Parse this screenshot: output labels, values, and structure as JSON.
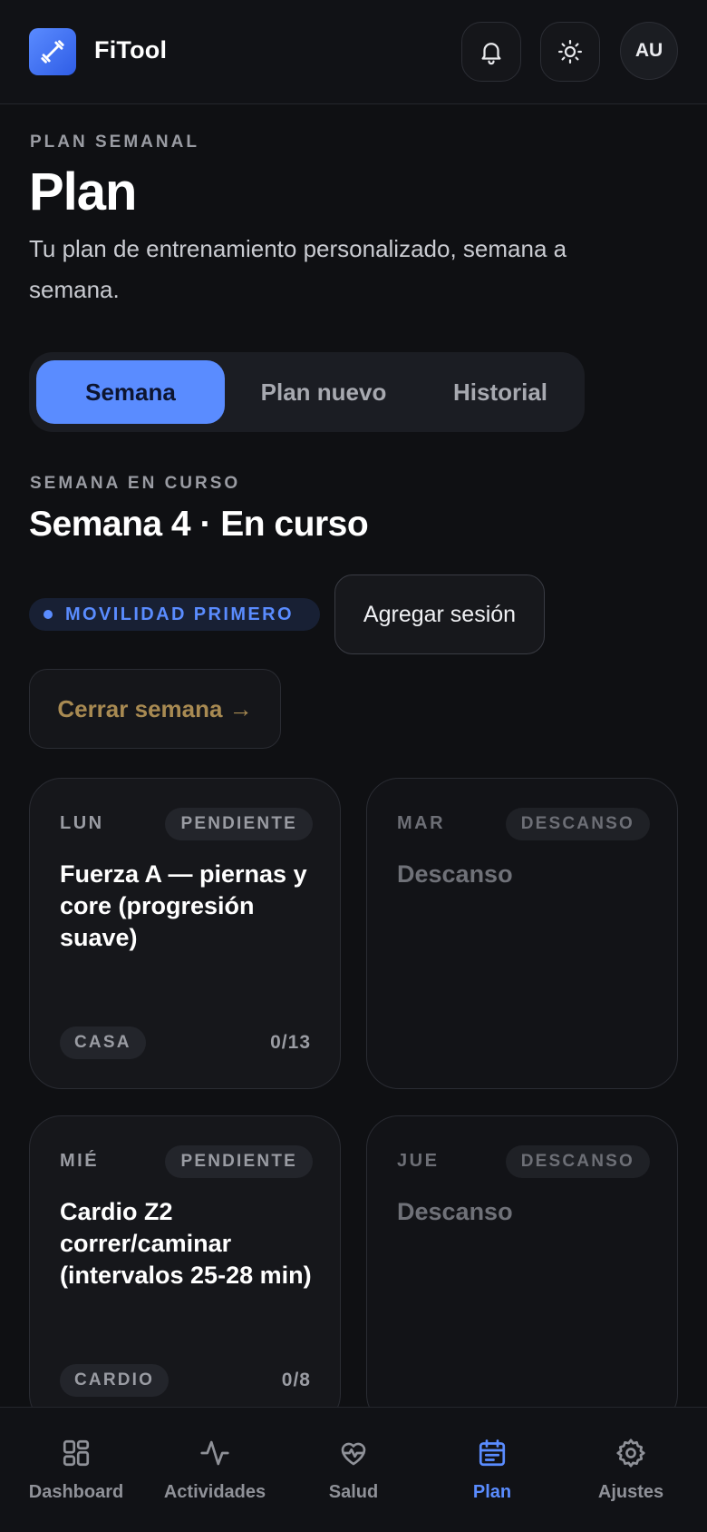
{
  "app": {
    "name": "FiTool",
    "avatar_initials": "AU"
  },
  "header": {
    "eyebrow": "PLAN SEMANAL",
    "title": "Plan",
    "subtitle": "Tu plan de entrenamiento personalizado, semana a semana."
  },
  "tabs": [
    {
      "label": "Semana",
      "active": true
    },
    {
      "label": "Plan nuevo",
      "active": false
    },
    {
      "label": "Historial",
      "active": false
    }
  ],
  "week": {
    "eyebrow": "SEMANA EN CURSO",
    "title": "Semana 4 · En curso",
    "focus_badge": "MOVILIDAD PRIMERO",
    "add_session_label": "Agregar sesión",
    "close_week_label": "Cerrar semana →"
  },
  "days": [
    {
      "day": "LUN",
      "status": "PENDIENTE",
      "title": "Fuerza A — piernas y core (progresión suave)",
      "tag": "CASA",
      "count": "0/13"
    },
    {
      "day": "MAR",
      "status": "DESCANSO",
      "title": "Descanso"
    },
    {
      "day": "MIÉ",
      "status": "PENDIENTE",
      "title": "Cardio Z2 correr/caminar (intervalos 25-28 min)",
      "tag": "CARDIO",
      "count": "0/8"
    },
    {
      "day": "JUE",
      "status": "DESCANSO",
      "title": "Descanso"
    }
  ],
  "nav": [
    {
      "label": "Dashboard",
      "icon": "grid-icon",
      "active": false
    },
    {
      "label": "Actividades",
      "icon": "activity-icon",
      "active": false
    },
    {
      "label": "Salud",
      "icon": "heart-pulse-icon",
      "active": false
    },
    {
      "label": "Plan",
      "icon": "calendar-icon",
      "active": true
    },
    {
      "label": "Ajustes",
      "icon": "gear-icon",
      "active": false
    }
  ],
  "colors": {
    "accent": "#5a8cff",
    "background": "#0f1013",
    "close_week_text": "#a88a52"
  }
}
